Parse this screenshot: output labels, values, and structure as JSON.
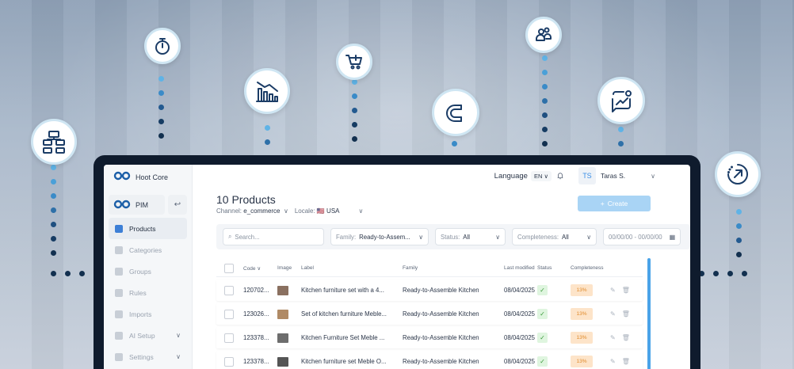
{
  "app": {
    "brand": "Hoot Core",
    "module": "PIM",
    "accent": "#1c5fa8"
  },
  "sidebar": {
    "items": [
      {
        "label": "Products",
        "icon": "cube-icon",
        "active": true
      },
      {
        "label": "Categories",
        "icon": "list-icon"
      },
      {
        "label": "Groups",
        "icon": "layers-icon"
      },
      {
        "label": "Rules",
        "icon": "rules-icon"
      },
      {
        "label": "Imports",
        "icon": "import-icon"
      },
      {
        "label": "AI Setup",
        "icon": "sparkle-icon",
        "chevron": "∨"
      },
      {
        "label": "Settings",
        "icon": "gear-icon",
        "chevron": "∨"
      }
    ]
  },
  "topbar": {
    "language_label": "Language",
    "language_value": "EN",
    "user_initials": "TS",
    "user_name": "Taras S."
  },
  "page": {
    "title": "10 Products",
    "channel_label": "Channel:",
    "channel_value": "e_commerce",
    "locale_label": "Locale:",
    "locale_value": "🇺🇸 USA",
    "create_label": "Create"
  },
  "filters": {
    "search_placeholder": "Search...",
    "family_label": "Family:",
    "family_value": "Ready-to-Assem...",
    "status_label": "Status:",
    "status_value": "All",
    "completeness_label": "Completeness:",
    "completeness_value": "All",
    "date_value": "00/00/00 - 00/00/00"
  },
  "table": {
    "headers": {
      "code": "Code ∨",
      "image": "Image",
      "label": "Label",
      "family": "Family",
      "modified": "Last modified",
      "status": "Status",
      "completeness": "Completeness"
    },
    "rows": [
      {
        "code": "120702...",
        "label": "Kitchen furniture set with a 4...",
        "family": "Ready-to-Assemble Kitchen",
        "modified": "08/04/2025",
        "status": "✓",
        "completeness": "13%",
        "thumb": "#8a7060"
      },
      {
        "code": "123026...",
        "label": "Set of kitchen furniture Meble...",
        "family": "Ready-to-Assemble Kitchen",
        "modified": "08/04/2025",
        "status": "✓",
        "completeness": "13%",
        "thumb": "#b08a65"
      },
      {
        "code": "123378...",
        "label": "Kitchen Furniture Set Meble ...",
        "family": "Ready-to-Assemble Kitchen",
        "modified": "08/04/2025",
        "status": "✓",
        "completeness": "13%",
        "thumb": "#6d6d6d"
      },
      {
        "code": "123378...",
        "label": "Kitchen furniture set Meble O...",
        "family": "Ready-to-Assemble Kitchen",
        "modified": "08/04/2025",
        "status": "✓",
        "completeness": "13%",
        "thumb": "#555555"
      }
    ]
  },
  "bubbles": [
    {
      "icon": "hierarchy-icon"
    },
    {
      "icon": "stopwatch-icon"
    },
    {
      "icon": "bar-chart-down-icon"
    },
    {
      "icon": "cart-icon"
    },
    {
      "icon": "magnet-icon"
    },
    {
      "icon": "users-icon"
    },
    {
      "icon": "growth-chat-icon"
    },
    {
      "icon": "progress-arrow-icon"
    }
  ]
}
